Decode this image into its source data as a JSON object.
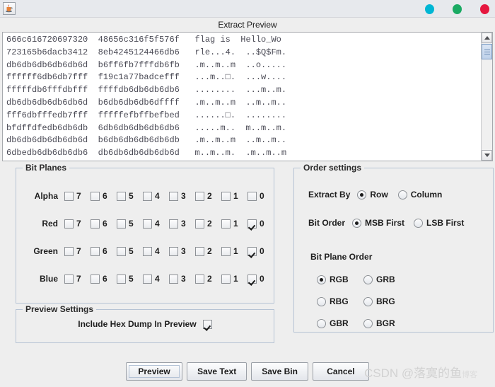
{
  "window": {
    "app_icon": "java-coffee-cup-icon",
    "controls": [
      {
        "name": "minimize",
        "color": "#00b6d4"
      },
      {
        "name": "maximize",
        "color": "#1aaa63"
      },
      {
        "name": "close",
        "color": "#e5173f"
      }
    ]
  },
  "dialog": {
    "caption": "Extract Preview"
  },
  "preview": {
    "hex_lines": [
      "666c616720697320  48656c316f5f576f   flag is  Hello_Wo",
      "723165b6dacb3412  8eb4245124466db6   rle...4.  ..$Q$Fm.",
      "db6db6db6db6db6d  b6ff6fb7fffdb6fb   .m..m..m  ..o.....",
      "ffffff6db6db7fff  f19c1a77badcefff   ...m..□.  ...w....",
      "fffffdb6fffdbfff  ffffdb6db6db6db6   ........  ...m..m.",
      "db6db6db6db6db6d  b6db6db6db6dffff   .m..m..m  ..m..m..",
      "fff6dbfffedb7fff  fffffefbffbefbed   ......□.  ........",
      "bfdffdfedb6db6db  6db6db6db6db6db6   .....m..  m..m..m.",
      "db6db6db6db6db6d  b6db6db6db6db6db   .m..m..m  ..m..m..",
      "6dbedb6db6db6db6  db6db6db6db6db6d   m..m..m.  .m..m..m"
    ],
    "scrollbar": {
      "up_icon": "scroll-up-arrow-icon",
      "down_icon": "scroll-down-arrow-icon"
    }
  },
  "bit_planes": {
    "title": "Bit Planes",
    "bits": [
      "7",
      "6",
      "5",
      "4",
      "3",
      "2",
      "1",
      "0"
    ],
    "channels": [
      {
        "label": "Alpha",
        "checked": [
          false,
          false,
          false,
          false,
          false,
          false,
          false,
          false
        ]
      },
      {
        "label": "Red",
        "checked": [
          false,
          false,
          false,
          false,
          false,
          false,
          false,
          true
        ]
      },
      {
        "label": "Green",
        "checked": [
          false,
          false,
          false,
          false,
          false,
          false,
          false,
          true
        ]
      },
      {
        "label": "Blue",
        "checked": [
          false,
          false,
          false,
          false,
          false,
          false,
          false,
          true
        ]
      }
    ]
  },
  "order_settings": {
    "title": "Order settings",
    "extract_by": {
      "label": "Extract By",
      "options": [
        "Row",
        "Column"
      ],
      "selected": "Row"
    },
    "bit_order": {
      "label": "Bit Order",
      "options": [
        "MSB First",
        "LSB First"
      ],
      "selected": "MSB First"
    },
    "bit_plane_order": {
      "label": "Bit Plane Order",
      "options": [
        "RGB",
        "GRB",
        "RBG",
        "BRG",
        "GBR",
        "BGR"
      ],
      "selected": "RGB"
    }
  },
  "preview_settings": {
    "title": "Preview Settings",
    "include_hex_dump": {
      "label": "Include Hex Dump In Preview",
      "checked": true
    }
  },
  "buttons": [
    {
      "label": "Preview",
      "focused": true
    },
    {
      "label": "Save Text",
      "focused": false
    },
    {
      "label": "Save Bin",
      "focused": false
    },
    {
      "label": "Cancel",
      "focused": false
    }
  ],
  "watermark": {
    "main": "CSDN @落寞的鱼",
    "suffix": "博客"
  }
}
